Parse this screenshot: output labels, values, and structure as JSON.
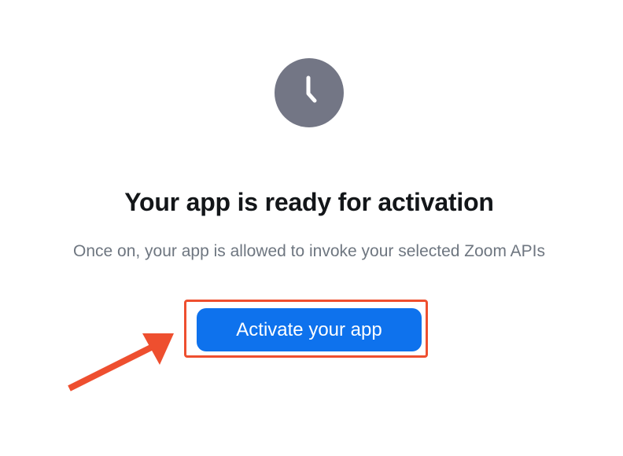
{
  "icon": {
    "name": "clock-icon",
    "color": "#737685"
  },
  "heading": "Your app is ready for activation",
  "description": "Once on, your app is allowed to invoke your selected Zoom APIs",
  "activate_button": {
    "label": "Activate your app",
    "color": "#0e72ed"
  },
  "annotation": {
    "arrow": "arrow-icon",
    "highlight_color": "#ee4f2f"
  }
}
